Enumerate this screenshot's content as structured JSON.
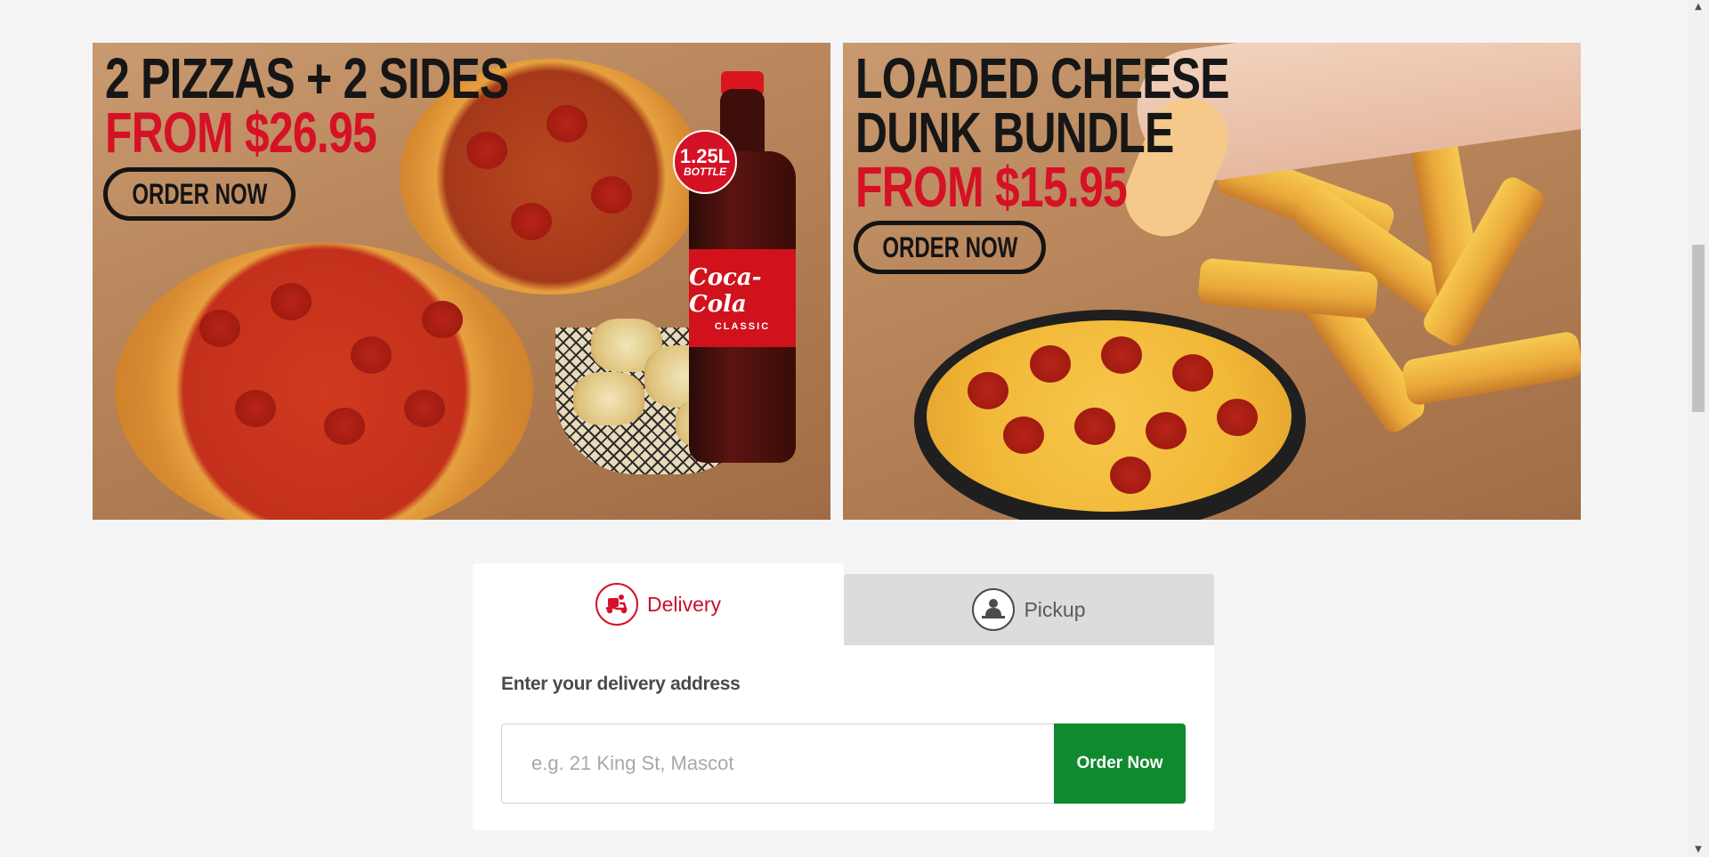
{
  "promos": {
    "pizzas_sides": {
      "headline_1": "2 PIZZAS + 2 SIDES",
      "headline_2": "FROM $26.95",
      "button": "ORDER NOW",
      "bottle_badge_size": "1.25L",
      "bottle_badge_word": "BOTTLE",
      "bottle_brand": "Coca-Cola",
      "bottle_variant": "CLASSIC"
    },
    "cheese_dunk": {
      "headline_1": "LOADED CHEESE",
      "headline_2": "DUNK BUNDLE",
      "headline_3": "FROM $15.95",
      "button": "ORDER NOW"
    }
  },
  "order": {
    "tabs": [
      {
        "label": "Delivery",
        "icon": "delivery-scooter-icon",
        "active": true
      },
      {
        "label": "Pickup",
        "icon": "pickup-person-icon",
        "active": false
      }
    ],
    "address_heading": "Enter your delivery address",
    "address_placeholder": "e.g. 21 King St, Mascot",
    "address_value": "",
    "submit_label": "Order Now"
  },
  "colors": {
    "brand_red": "#d51126",
    "order_green": "#0f8a2e",
    "inactive_tab": "#dcdcdf",
    "page_bg": "#f5f5f5"
  }
}
